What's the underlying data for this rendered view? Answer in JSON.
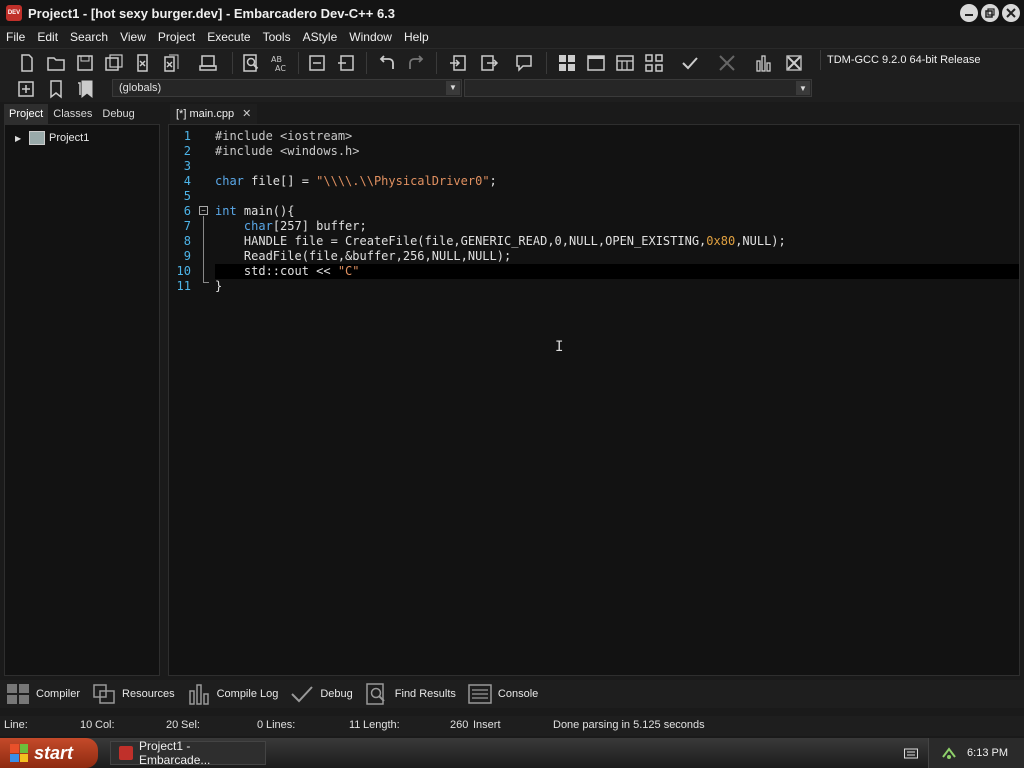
{
  "window": {
    "title": "Project1 - [hot sexy burger.dev] - Embarcadero Dev-C++ 6.3",
    "icon_text": "DEV"
  },
  "menu": [
    "File",
    "Edit",
    "Search",
    "View",
    "Project",
    "Execute",
    "Tools",
    "AStyle",
    "Window",
    "Help"
  ],
  "toolbar": {
    "compiler": "TDM-GCC 9.2.0 64-bit Release",
    "globals": "(globals)"
  },
  "left_panel": {
    "tabs": [
      "Project",
      "Classes",
      "Debug"
    ],
    "active_tab": "Project",
    "tree": {
      "project_name": "Project1"
    }
  },
  "editor": {
    "tab_label": "[*] main.cpp",
    "line_numbers": [
      "1",
      "2",
      "3",
      "4",
      "5",
      "6",
      "7",
      "8",
      "9",
      "10",
      "11"
    ],
    "current_line": 10,
    "lines": [
      "#include <iostream>",
      "#include <windows.h>",
      "",
      "char file[] = \"\\\\\\\\.\\\\PhysicalDriver0\";",
      "",
      "int main(){",
      "    char[257] buffer;",
      "    HANDLE file = CreateFile(file,GENERIC_READ,0,NULL,OPEN_EXISTING,0x80,NULL);",
      "    ReadFile(file,&buffer,256,NULL,NULL);",
      "    std::cout << \"C\"",
      "}"
    ]
  },
  "bottom_tabs": [
    "Compiler",
    "Resources",
    "Compile Log",
    "Debug",
    "Find Results",
    "Console"
  ],
  "status": {
    "line_label": "Line:",
    "line_value": "10",
    "col_label": "Col:",
    "col_value": "20",
    "sel_label": "Sel:",
    "sel_value": "0",
    "lines_label": "Lines:",
    "lines_value": "11",
    "length_label": "Length:",
    "length_value": "260",
    "mode": "Insert",
    "message": "Done parsing in 5.125 seconds"
  },
  "taskbar": {
    "start_label": "start",
    "task_label": "Project1 - Embarcade...",
    "clock": "6:13 PM"
  },
  "colors": {
    "keyword": "#5aa8e8",
    "string": "#e09060",
    "number": "#e0a040",
    "gutter": "#4db4e8"
  }
}
